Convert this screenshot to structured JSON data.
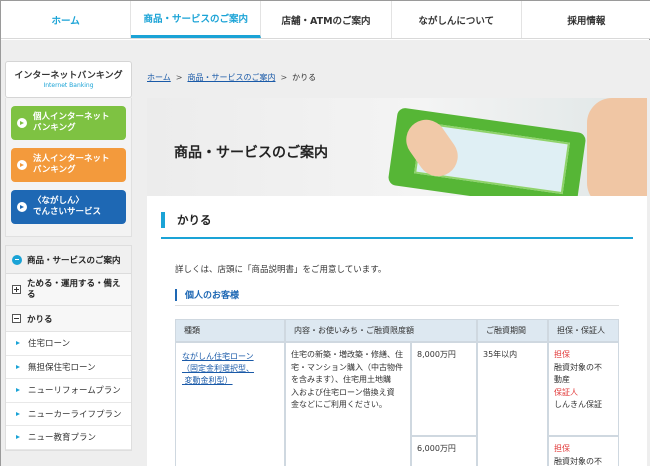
{
  "top_nav": [
    "ホーム",
    "商品・サービスのご案内",
    "店舗・ATMのご案内",
    "ながしんについて",
    "採用情報"
  ],
  "internet_banking": {
    "title": "インターネットバンキング",
    "subtitle": "Internet Banking",
    "buttons": [
      {
        "line1": "個人インターネット",
        "line2": "バンキング"
      },
      {
        "line1": "法人インターネット",
        "line2": "バンキング"
      },
      {
        "line1": "〈ながしん〉",
        "line2": "でんさいサービス"
      }
    ]
  },
  "side_menu": {
    "head": "商品・サービスのご案内",
    "save": {
      "line1": "ためる・運用する・備え",
      "line2": "る"
    },
    "borrow": "かりる",
    "links": [
      "住宅ローン",
      "無担保住宅ローン",
      "ニューリフォームプラン",
      "ニューカーライフプラン",
      "ニュー教育プラン"
    ]
  },
  "breadcrumb": {
    "home": "ホーム",
    "services": "商品・サービスのご案内",
    "current": "かりる"
  },
  "hero": {
    "title": "商品・サービスのご案内"
  },
  "section": {
    "title": "かりる"
  },
  "intro": "詳しくは、店頭に「商品説明書」をご用意しています。",
  "subsection": {
    "title": "個人のお客様"
  },
  "table": {
    "headers": [
      "種類",
      "内容・お使いみち・ご融資限度額",
      "ご融資期間",
      "担保・保証人"
    ],
    "row1": {
      "type_l1": "ながしん住宅ローン",
      "type_l2": "（固定金利選択型、",
      "type_l3": "変動金利型）",
      "content_l1": "住宅の新築・増改築・修繕、住",
      "content_l2": "宅・マンション購入（中古物件",
      "content_l3": "を含みます）、住宅用土地購",
      "content_l4": "入および住宅ローン借換え資",
      "content_l5": "金などにご利用ください。",
      "limit1": "8,000万円",
      "limit2": "6,000万円",
      "period": "35年以内",
      "g1_label": "担保",
      "g1_l1": "融資対象の不",
      "g1_l2": "動産",
      "g2_label": "保証人",
      "g2_l1": "しんきん保証",
      "g3_label": "担保",
      "g3_l1": "融資対象の不"
    }
  }
}
